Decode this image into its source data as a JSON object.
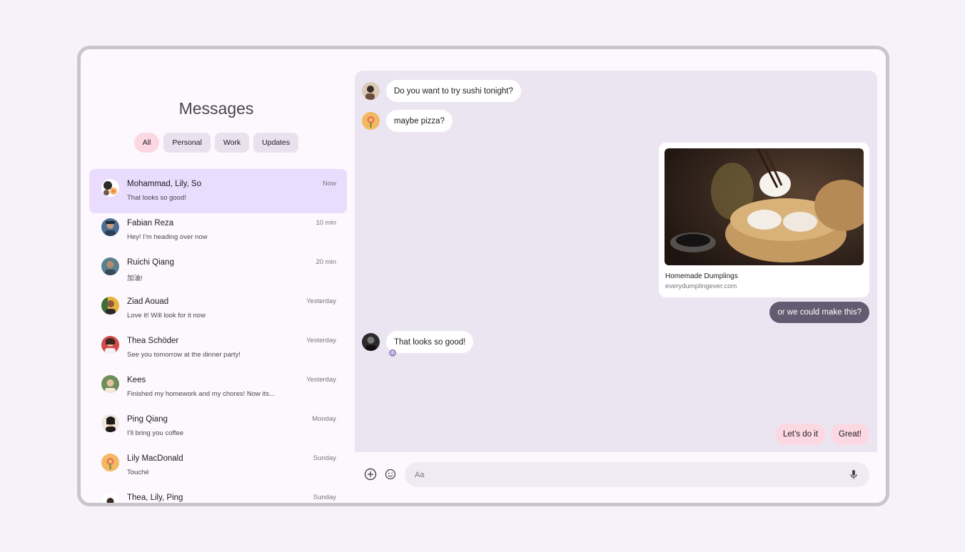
{
  "messages_pane": {
    "title": "Messages",
    "filters": [
      {
        "label": "All",
        "active": true
      },
      {
        "label": "Personal",
        "active": false
      },
      {
        "label": "Work",
        "active": false
      },
      {
        "label": "Updates",
        "active": false
      }
    ],
    "conversations": [
      {
        "name": "Mohammad, Lily, So",
        "preview": "That looks so good!",
        "time": "Now",
        "selected": true
      },
      {
        "name": "Fabian Reza",
        "preview": "Hey! I’m heading over now",
        "time": "10 min"
      },
      {
        "name": "Ruichi Qiang",
        "preview": "加油!",
        "time": "20 min"
      },
      {
        "name": "Ziad Aouad",
        "preview": "Love it! Will look for it now",
        "time": "Yesterday"
      },
      {
        "name": "Thea Schöder",
        "preview": "See you tomorrow at the dinner party!",
        "time": "Yesterday"
      },
      {
        "name": "Kees",
        "preview": "Finished my homework and my chores! Now its...",
        "time": "Yesterday"
      },
      {
        "name": "Ping Qiang",
        "preview": "I’ll bring you coffee",
        "time": "Monday"
      },
      {
        "name": "Lily MacDonald",
        "preview": "Touché",
        "time": "Sunday"
      },
      {
        "name": "Thea, Lily, Ping",
        "preview": "",
        "time": "Sunday"
      }
    ]
  },
  "chat": {
    "messages": [
      {
        "text": "Do you want to try sushi tonight?"
      },
      {
        "text": "maybe pizza?"
      },
      {
        "text": "That looks so good!"
      }
    ],
    "link_card": {
      "title": "Homemade Dumplings",
      "url": "everydumplingever.com"
    },
    "outgoing": "or we could make this?",
    "suggestions": [
      "Let’s do it",
      "Great!"
    ],
    "reaction_icon": "smile-icon"
  },
  "composer": {
    "placeholder": "Aa",
    "icons": [
      "add-circle-icon",
      "emoji-icon",
      "mic-icon"
    ]
  },
  "colors": {
    "selected_row": "#eadcfd",
    "chip_active": "#fcd9e2",
    "outgoing_bubble": "#625b71",
    "chat_bg": "#ebe5f1"
  }
}
